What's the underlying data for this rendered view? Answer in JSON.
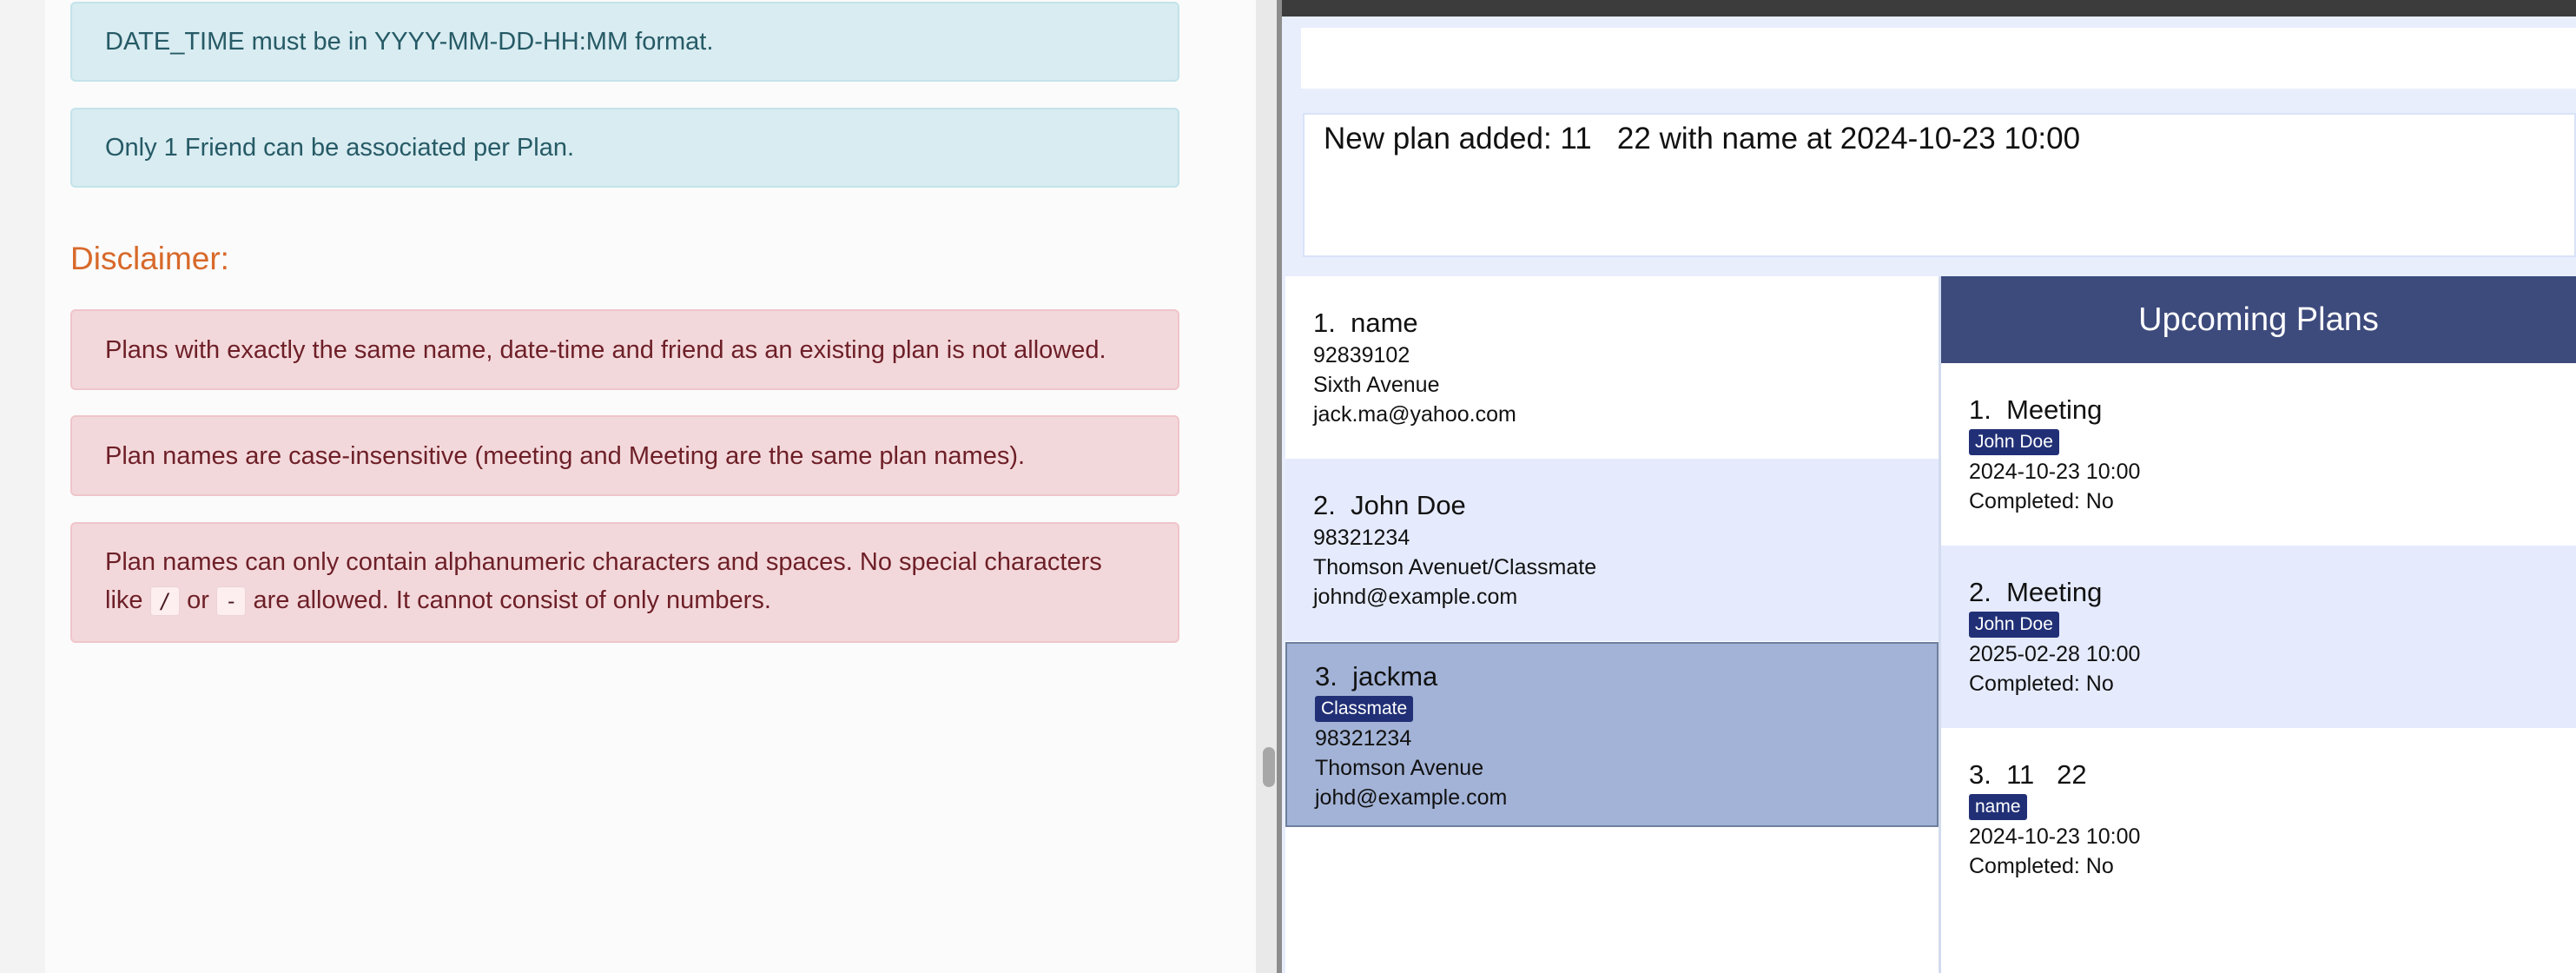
{
  "doc": {
    "info_notes": [
      "DATE_TIME must be in YYYY-MM-DD-HH:MM format.",
      "Only 1 Friend can be associated per Plan."
    ],
    "disclaimer_heading": "Disclaimer:",
    "danger_notes": [
      "Plans with exactly the same name, date-time and friend as an existing plan is not allowed.",
      "Plan names are case-insensitive (meeting and Meeting are the same plan names)."
    ],
    "special_note": {
      "part1": "Plan names can only contain alphanumeric characters and spaces. No special characters like",
      "code1": "/",
      "part2": "or",
      "code2": "-",
      "part3": "are allowed. It cannot consist of only numbers."
    }
  },
  "app": {
    "command_value": "",
    "result_message": "New plan added: 11   22 with name at 2024-10-23 10:00",
    "friends": [
      {
        "index": "1.",
        "name": "name",
        "tag": "",
        "phone": "92839102",
        "address": "Sixth Avenue",
        "email": "jack.ma@yahoo.com"
      },
      {
        "index": "2.",
        "name": "John Doe",
        "tag": "",
        "phone": "98321234",
        "address": "Thomson Avenuet/Classmate",
        "email": "johnd@example.com"
      },
      {
        "index": "3.",
        "name": "jackma",
        "tag": "Classmate",
        "phone": "98321234",
        "address": "Thomson Avenue",
        "email": "johd@example.com"
      }
    ],
    "plans_title": "Upcoming Plans",
    "plans": [
      {
        "index": "1.",
        "name": "Meeting",
        "friend": "John Doe",
        "datetime": "2024-10-23 10:00",
        "status": "Completed: No"
      },
      {
        "index": "2.",
        "name": "Meeting",
        "friend": "John Doe",
        "datetime": "2025-02-28 10:00",
        "status": "Completed: No"
      },
      {
        "index": "3.",
        "name": "11   22",
        "friend": "name",
        "datetime": "2024-10-23 10:00",
        "status": "Completed: No"
      }
    ]
  },
  "colors": {
    "info_bg": "#d8ecf1",
    "danger_bg": "#f3d8db",
    "disclaimer": "#d8692a",
    "plans_header_bg": "#3d4a7c",
    "tag_bg": "#213076",
    "selected_card": "#a3b3d7"
  }
}
